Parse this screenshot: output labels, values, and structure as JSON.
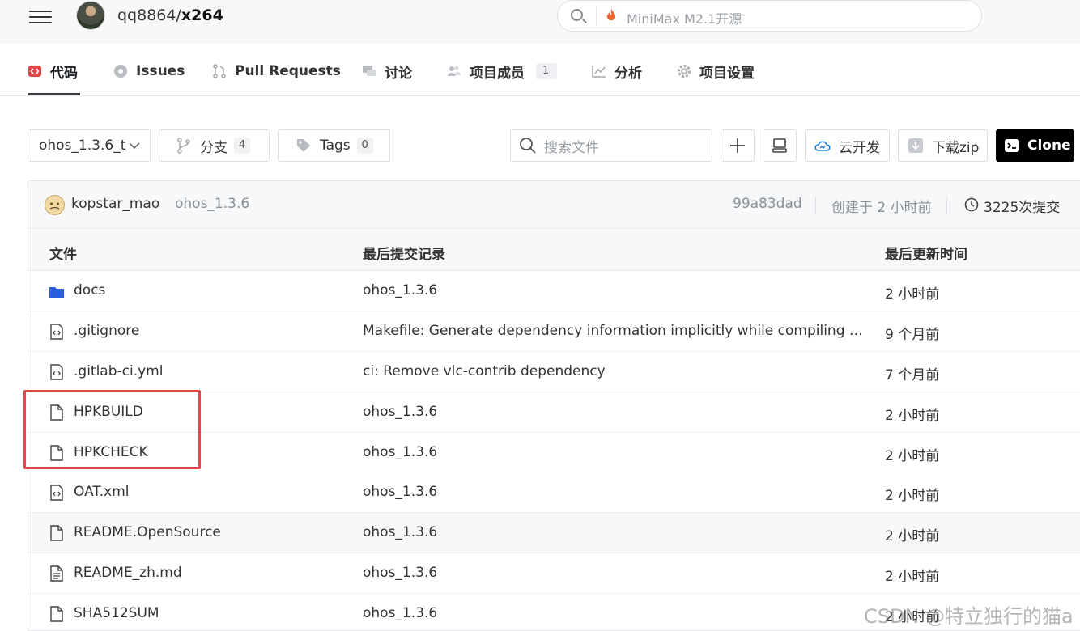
{
  "header": {
    "repo_owner": "qq8864/",
    "repo_name": "x264",
    "search_hint": "MiniMax M2.1开源"
  },
  "tabs": [
    {
      "label": "代码"
    },
    {
      "label": "Issues"
    },
    {
      "label": "Pull Requests"
    },
    {
      "label": "讨论"
    },
    {
      "label": "项目成员",
      "count": "1"
    },
    {
      "label": "分析"
    },
    {
      "label": "项目设置"
    }
  ],
  "toolbar": {
    "branch_select": "ohos_1.3.6_t",
    "branches_label": "分支",
    "branches_count": "4",
    "tags_label": "Tags",
    "tags_count": "0",
    "file_search_placeholder": "搜索文件",
    "cloud_dev_label": "云开发",
    "download_label": "下载zip",
    "clone_label": "Clone"
  },
  "commit": {
    "author": "kopstar_mao",
    "message": "ohos_1.3.6",
    "hash": "99a83dad",
    "created": "创建于 2 小时前",
    "commit_count": "3225次提交"
  },
  "table": {
    "headers": [
      "文件",
      "最后提交记录",
      "最后更新时间"
    ],
    "rows": [
      {
        "name": "docs",
        "type": "folder",
        "message": "ohos_1.3.6",
        "time": "2 小时前"
      },
      {
        "name": ".gitignore",
        "type": "code",
        "message": "Makefile: Generate dependency information implicitly while compiling …",
        "time": "9 个月前"
      },
      {
        "name": ".gitlab-ci.yml",
        "type": "code",
        "message": "ci: Remove vlc-contrib dependency",
        "time": "7 个月前"
      },
      {
        "name": "HPKBUILD",
        "type": "file",
        "message": "ohos_1.3.6",
        "time": "2 小时前"
      },
      {
        "name": "HPKCHECK",
        "type": "file",
        "message": "ohos_1.3.6",
        "time": "2 小时前"
      },
      {
        "name": "OAT.xml",
        "type": "code",
        "message": "ohos_1.3.6",
        "time": "2 小时前"
      },
      {
        "name": "README.OpenSource",
        "type": "file",
        "message": "ohos_1.3.6",
        "time": "2 小时前"
      },
      {
        "name": "README_zh.md",
        "type": "doc",
        "message": "ohos_1.3.6",
        "time": "2 小时前"
      },
      {
        "name": "SHA512SUM",
        "type": "file",
        "message": "ohos_1.3.6",
        "time": "2 小时前"
      }
    ]
  },
  "watermark": "CSDN @特立独行的猫a",
  "colors": {
    "accent_red": "#e4474a",
    "folder_blue": "#2b5fd9",
    "clone_bg": "#000000"
  }
}
